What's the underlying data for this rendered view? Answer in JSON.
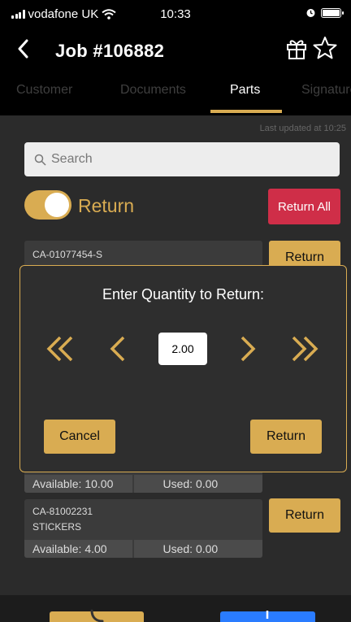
{
  "status_bar": {
    "carrier": "vodafone UK",
    "time": "10:33"
  },
  "nav": {
    "title": "Job #106882"
  },
  "tabs": [
    {
      "label": "Customer"
    },
    {
      "label": "Documents"
    },
    {
      "label": "Parts",
      "active": true
    },
    {
      "label": "Signature"
    }
  ],
  "last_updated": "Last updated at 10:25",
  "search": {
    "placeholder": "Search"
  },
  "return_toggle": {
    "label": "Return",
    "on": true
  },
  "return_all_label": "Return All",
  "parts": [
    {
      "code": "CA-01077454-S",
      "action": "Return"
    },
    {
      "available": "Available: 10.00",
      "used": "Used: 0.00"
    },
    {
      "code": "CA-81002231",
      "name": "STICKERS",
      "available": "Available: 4.00",
      "used": "Used: 0.00",
      "action": "Return"
    }
  ],
  "dialog": {
    "title": "Enter Quantity to Return:",
    "quantity": "2.00",
    "cancel_label": "Cancel",
    "return_label": "Return"
  },
  "colors": {
    "accent": "#d9ac52",
    "danger": "#cf2e48",
    "primary": "#2a7cff",
    "background": "#2b2b2b"
  }
}
